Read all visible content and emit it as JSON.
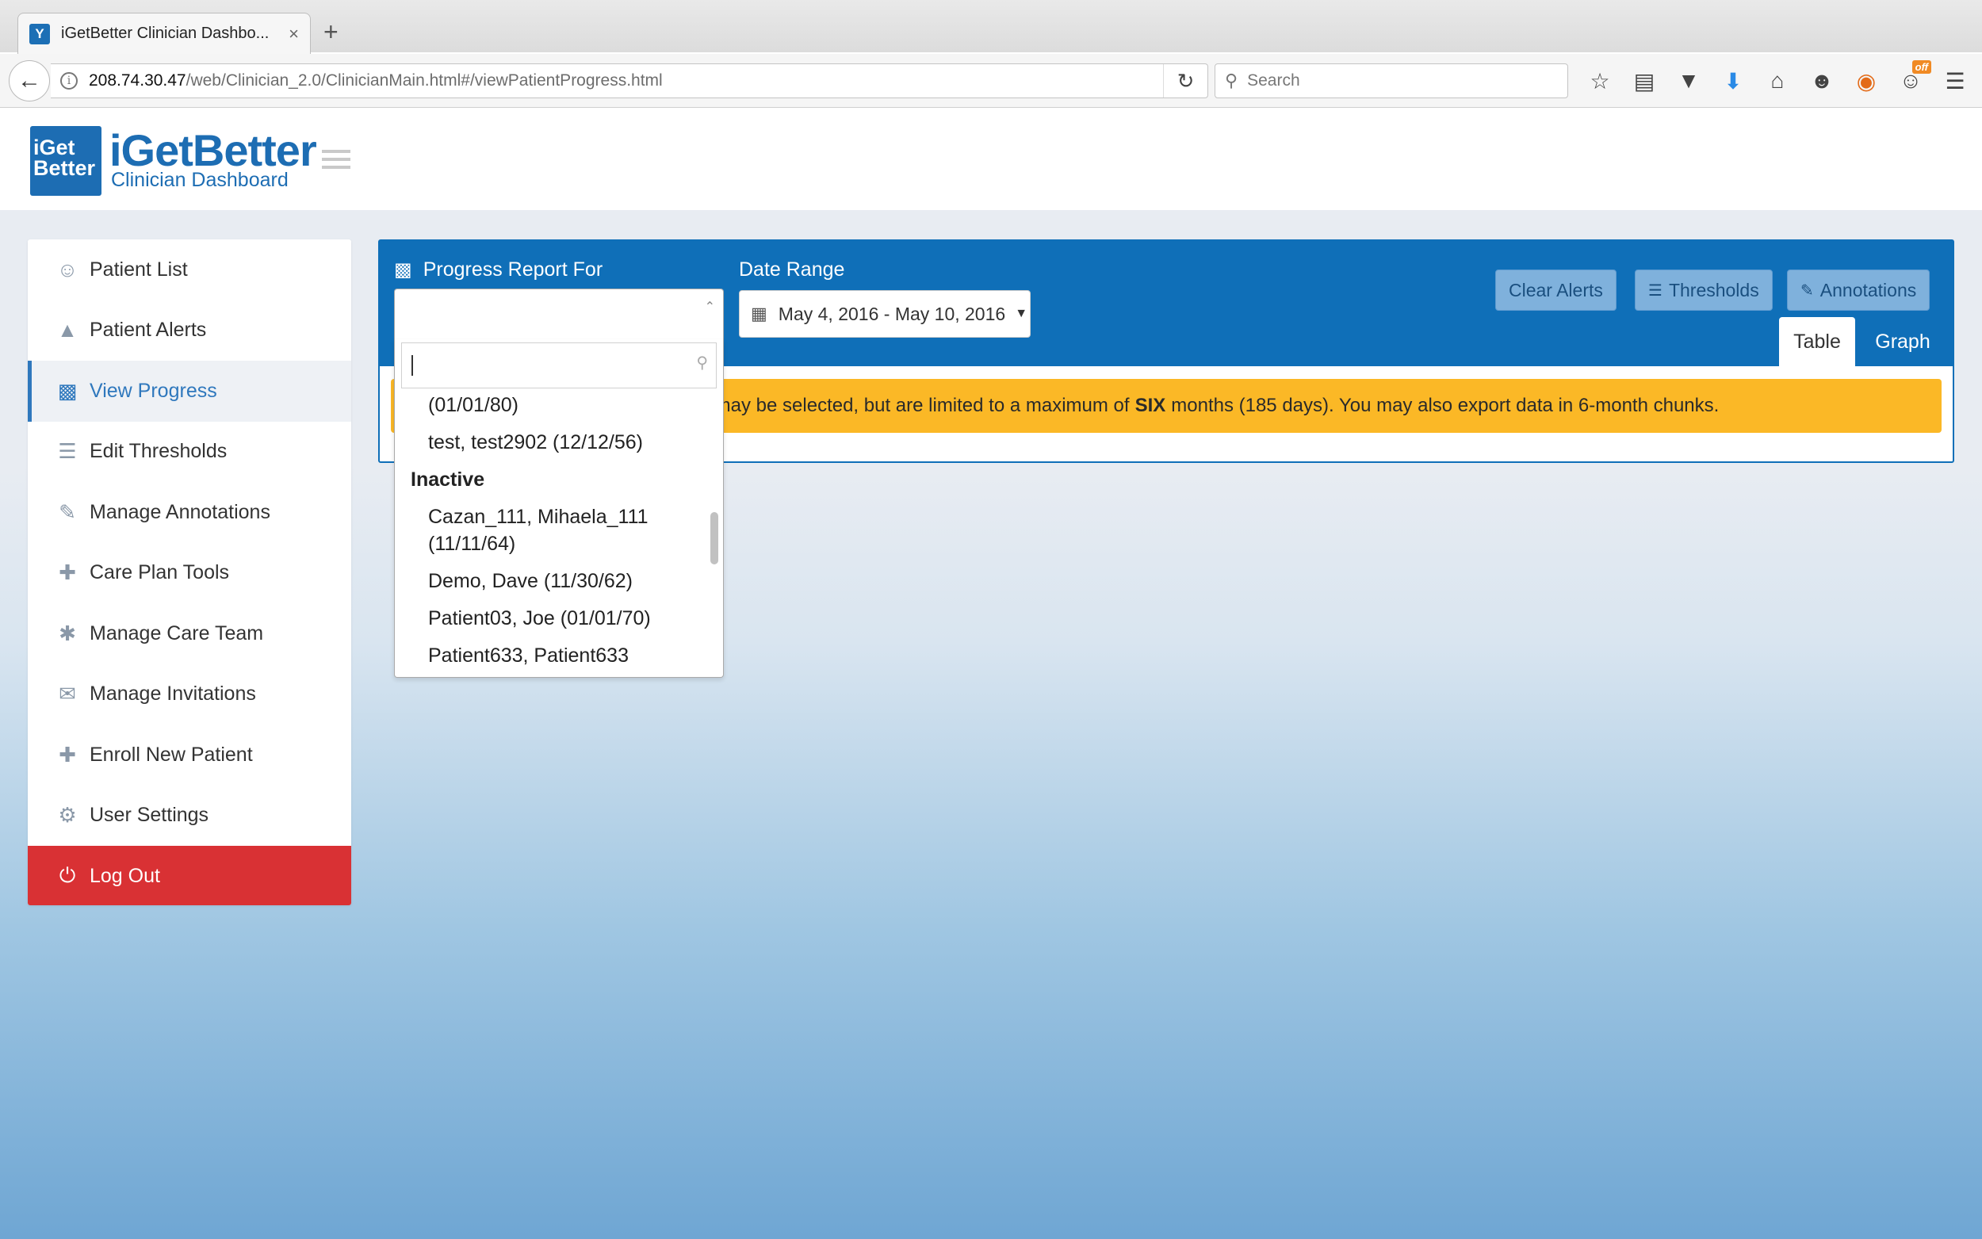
{
  "browser": {
    "tab_title": "iGetBetter Clinician Dashbo...",
    "tab_close": "×",
    "new_tab": "+",
    "url_host": "208.74.30.47",
    "url_path": "/web/Clinician_2.0/ClinicianMain.html#/viewPatientProgress.html",
    "search_placeholder": "Search",
    "addon_badge": "off"
  },
  "header": {
    "logo_text_line1": "iGet",
    "logo_text_line2": "Better",
    "title": "iGetBetter",
    "subtitle": "Clinician Dashboard"
  },
  "sidebar": {
    "items": [
      {
        "label": "Patient List",
        "icon": "user-icon"
      },
      {
        "label": "Patient Alerts",
        "icon": "warning-icon"
      },
      {
        "label": "View Progress",
        "icon": "bar-chart-icon",
        "active": true
      },
      {
        "label": "Edit Thresholds",
        "icon": "list-icon"
      },
      {
        "label": "Manage Annotations",
        "icon": "edit-icon"
      },
      {
        "label": "Care Plan Tools",
        "icon": "medkit-icon"
      },
      {
        "label": "Manage Care Team",
        "icon": "person-icon"
      },
      {
        "label": "Manage Invitations",
        "icon": "envelope-icon"
      },
      {
        "label": "Enroll New Patient",
        "icon": "user-plus-icon"
      },
      {
        "label": "User Settings",
        "icon": "gear-icon"
      },
      {
        "label": "Log Out",
        "icon": "power-icon"
      }
    ]
  },
  "panel": {
    "report_label": "Progress Report For",
    "date_label": "Date Range",
    "date_value": "May 4, 2016 - May 10, 2016",
    "buttons": {
      "clear_alerts": "Clear Alerts",
      "thresholds": "Thresholds",
      "annotations": "Annotations"
    },
    "tabs": {
      "table": "Table",
      "graph": "Graph"
    },
    "alert": {
      "pre": "s may be selected, but are limited to a maximum of",
      "bold": "SIX",
      "post": "months (185 days). You may also export data in 6-month chunks."
    }
  },
  "dropdown": {
    "search_value": "",
    "options": [
      {
        "type": "option",
        "label": "(01/01/80)"
      },
      {
        "type": "option",
        "label": "test, test2902 (12/12/56)"
      },
      {
        "type": "group",
        "label": "Inactive"
      },
      {
        "type": "option",
        "label": "Cazan_111, Mihaela_111 (11/11/64)"
      },
      {
        "type": "option",
        "label": "Demo, Dave (11/30/62)"
      },
      {
        "type": "option",
        "label": "Patient03, Joe (01/01/70)"
      },
      {
        "type": "option",
        "label": "Patient633, Patient633"
      }
    ]
  },
  "colors": {
    "brand_blue": "#0f6fb8",
    "alert_yellow": "#fbb826",
    "logout_red": "#d93134",
    "active_blue": "#2f78bd"
  }
}
